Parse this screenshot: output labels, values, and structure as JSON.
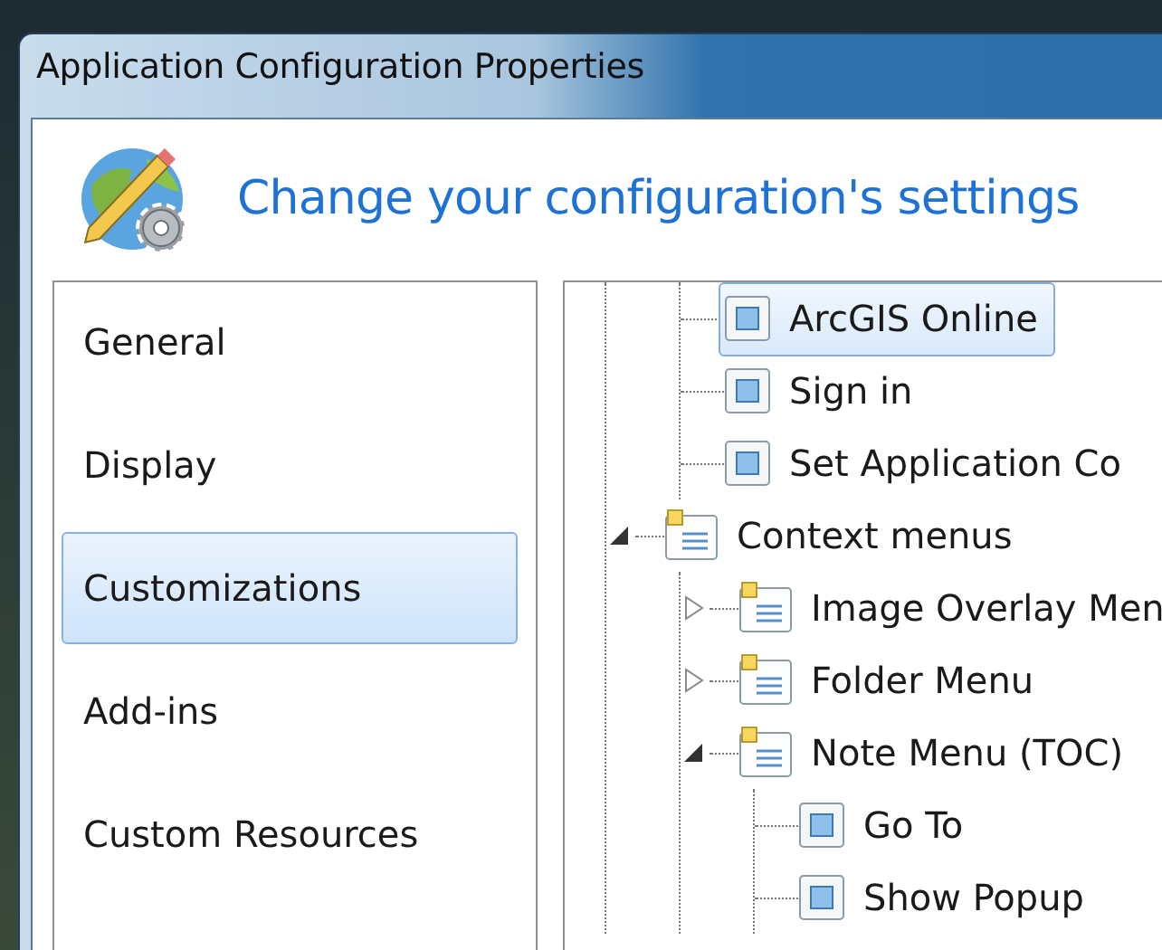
{
  "window": {
    "title": "Application Configuration Properties"
  },
  "header": {
    "heading": "Change your configuration's settings"
  },
  "sidebar": {
    "items": [
      {
        "label": "General",
        "selected": false
      },
      {
        "label": "Display",
        "selected": false
      },
      {
        "label": "Customizations",
        "selected": true
      },
      {
        "label": "Add-ins",
        "selected": false
      },
      {
        "label": "Custom Resources",
        "selected": false
      }
    ]
  },
  "tree": [
    {
      "kind": "continued",
      "children": [
        {
          "kind": "command",
          "label": "ArcGIS Online",
          "selected": true
        },
        {
          "kind": "command",
          "label": "Sign in",
          "selected": false
        },
        {
          "kind": "command",
          "label": "Set Application Co",
          "selected": false
        }
      ]
    },
    {
      "kind": "menu",
      "label": "Context menus",
      "expanded": true,
      "selected": false,
      "children": [
        {
          "kind": "menu",
          "label": "Image Overlay Men",
          "expanded": false,
          "selected": false
        },
        {
          "kind": "menu",
          "label": "Folder Menu",
          "expanded": false,
          "selected": false
        },
        {
          "kind": "menu",
          "label": "Note Menu (TOC)",
          "expanded": true,
          "selected": false,
          "children": [
            {
              "kind": "command",
              "label": "Go To",
              "selected": false
            },
            {
              "kind": "command",
              "label": "Show Popup",
              "selected": false
            }
          ]
        }
      ]
    }
  ]
}
